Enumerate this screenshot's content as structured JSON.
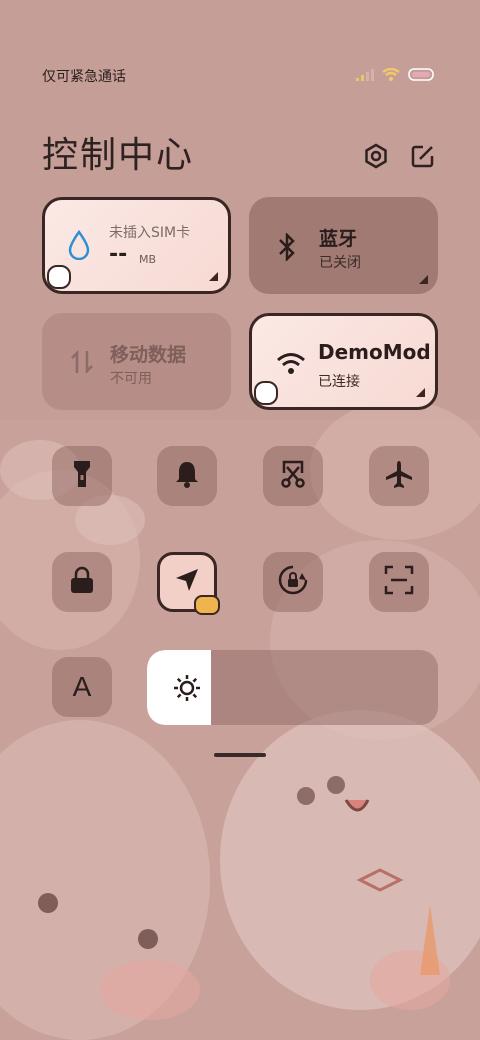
{
  "status_bar": {
    "carrier": "仅可紧急通话"
  },
  "header": {
    "title": "控制中心",
    "settings_icon": "gear-icon",
    "edit_icon": "edit-icon"
  },
  "tiles": {
    "data_usage": {
      "title": "未插入SIM卡",
      "value": "--",
      "unit": "MB",
      "active": true
    },
    "bluetooth": {
      "title": "蓝牙",
      "status": "已关闭",
      "active": false
    },
    "mobile_data": {
      "title": "移动数据",
      "status": "不可用",
      "active": false
    },
    "wifi": {
      "title": "DemoMod",
      "status": "已连接",
      "active": true
    }
  },
  "quick_toggles": [
    {
      "name": "flashlight",
      "icon": "flashlight-icon",
      "active": false
    },
    {
      "name": "mute",
      "icon": "bell-icon",
      "active": false
    },
    {
      "name": "screenshot",
      "icon": "screenshot-icon",
      "active": false
    },
    {
      "name": "airplane-mode",
      "icon": "airplane-icon",
      "active": false
    },
    {
      "name": "lock-screen",
      "icon": "lock-icon",
      "active": false
    },
    {
      "name": "location",
      "icon": "location-icon",
      "active": true
    },
    {
      "name": "auto-rotate",
      "icon": "rotate-lock-icon",
      "active": false
    },
    {
      "name": "scanner",
      "icon": "scan-icon",
      "active": false
    }
  ],
  "font_size_button": {
    "label": "A"
  },
  "brightness": {
    "level": 0.22,
    "icon": "sun-icon"
  },
  "colors": {
    "accent_light": "#fbe9e5",
    "tile_border": "#3a2623",
    "background": "#c9a19b"
  }
}
